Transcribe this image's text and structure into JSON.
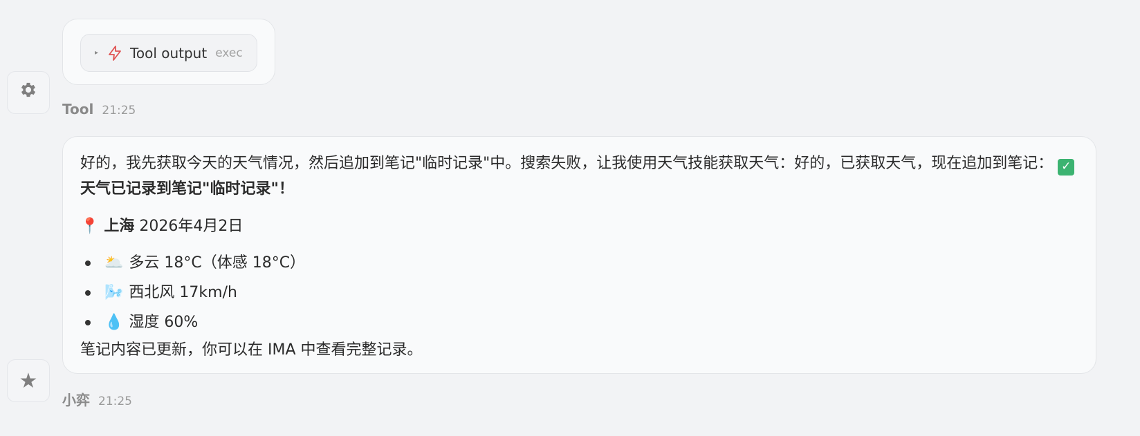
{
  "tool_message": {
    "chip_caret": "▸",
    "chip_label": "Tool output",
    "chip_tag": "exec",
    "sender": "Tool",
    "time": "21:25",
    "avatar_icon": "gear-icon"
  },
  "assistant_message": {
    "sender": "小弈",
    "time": "21:25",
    "avatar_icon": "star-icon",
    "intro_text": "好的，我先获取今天的天气情况，然后追加到笔记\"临时记录\"中。搜索失败，让我使用天气技能获取天气：好的，已获取天气，现在追加到笔记：",
    "success_text": "天气已记录到笔记\"临时记录\"！",
    "location_emoji": "📍",
    "location_city": "上海",
    "location_date": "2026年4月2日",
    "weather_items": [
      {
        "emoji": "🌥️",
        "text": "多云 18°C（体感 18°C）"
      },
      {
        "emoji": "🌬️",
        "text": "西北风 17km/h"
      },
      {
        "emoji": "💧",
        "text": "湿度 60%"
      }
    ],
    "footer_text": "笔记内容已更新，你可以在 IMA 中查看完整记录。"
  },
  "colors": {
    "bolt_icon": "#e05252",
    "check_icon": "#3cb371",
    "page_bg": "#f2f3f5"
  }
}
